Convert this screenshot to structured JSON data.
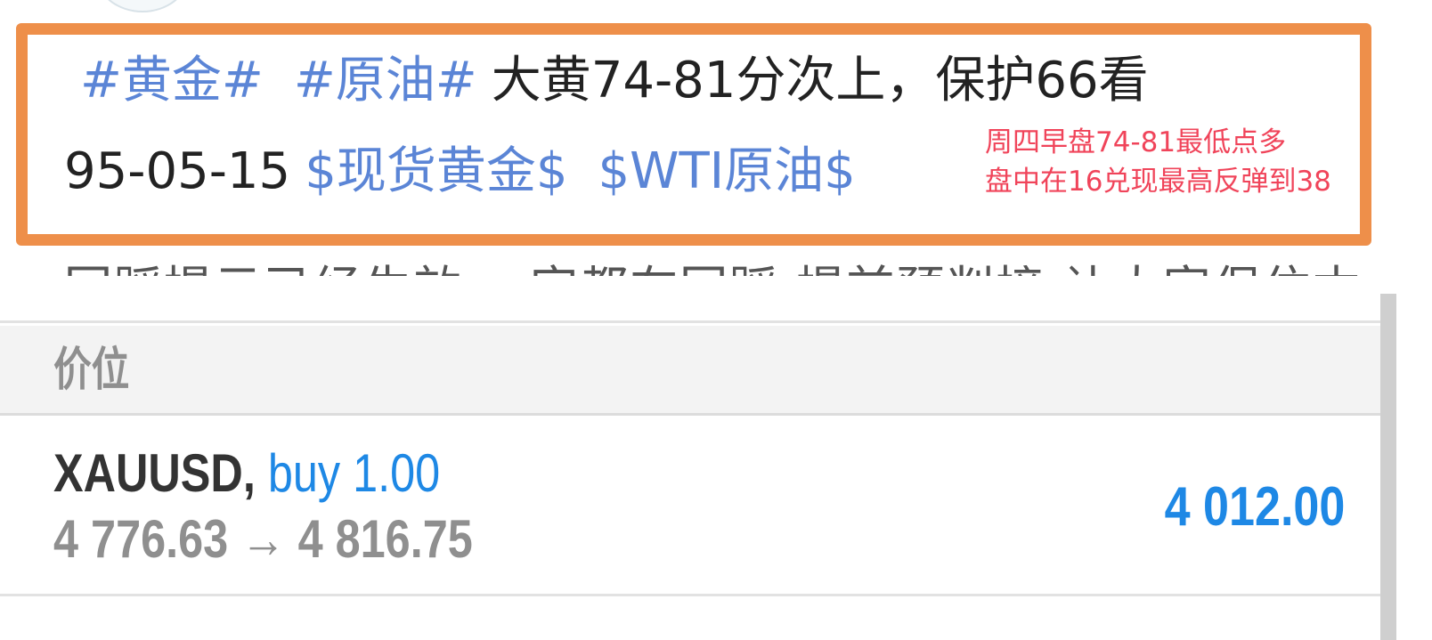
{
  "post": {
    "hashtag_gold": "#黄金#",
    "hashtag_oil": "#原油#",
    "text_line1": "大黄74-81分次上，保护66看",
    "text_line2": "95-05-15",
    "cashtag_gold": "$现货黄金$",
    "cashtag_oil": "$WTI原油$",
    "truncated_line": "回踩提示已经生效 一字都在回踩 提前预判接 让大家保住本"
  },
  "annotation": {
    "line1": "周四早盘74-81最低点多",
    "line2": "盘中在16兑现最高反弹到38"
  },
  "trading": {
    "section_title": "价位",
    "order": {
      "symbol": "XAUUSD,",
      "type": "buy 1.00",
      "prices": "4 776.63 → 4 816.75",
      "profit": "4 012.00"
    }
  },
  "colors": {
    "highlight_border": "#ee8f4a",
    "link_blue": "#5b85d6",
    "annotation_red": "#f0445a",
    "profit_blue": "#1e88e5"
  }
}
